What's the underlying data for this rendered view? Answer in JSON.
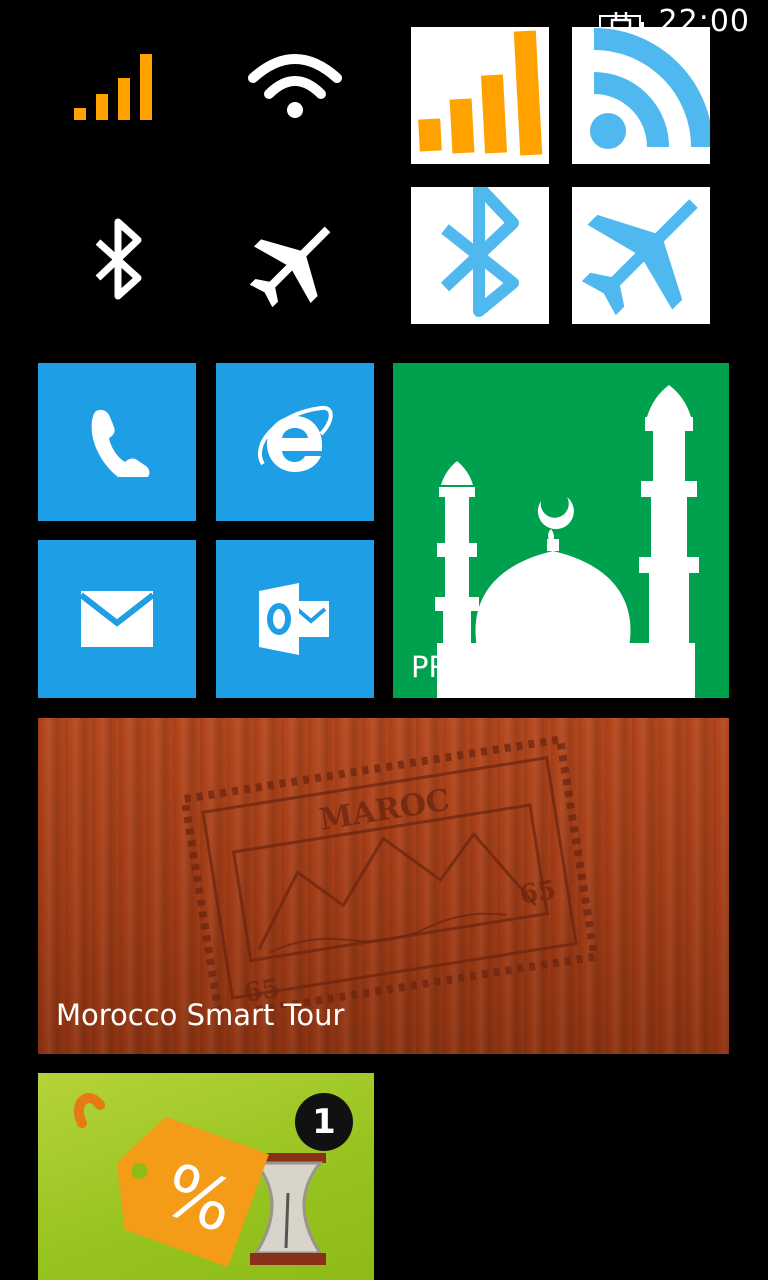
{
  "status_bar": {
    "time": "22:00",
    "battery_icon": "battery-charging-icon"
  },
  "quick_settings": {
    "icons": [
      "signal-strength-icon",
      "wifi-icon",
      "bluetooth-icon",
      "airplane-mode-icon"
    ],
    "accent_colors": {
      "signal": "#ffa200",
      "glyph": "#ffffff"
    }
  },
  "tiles": {
    "signal": {
      "icon": "signal-strength-icon",
      "color": "#ffa200"
    },
    "wifi_rss": {
      "icon": "rss-wifi-icon",
      "color": "#4fb8ef"
    },
    "bluetooth": {
      "icon": "bluetooth-icon",
      "color": "#4fb8ef"
    },
    "airplane": {
      "icon": "airplane-icon",
      "color": "#4fb8ef"
    },
    "phone": {
      "icon": "phone-icon",
      "color": "#1e9ee4"
    },
    "internet_explorer": {
      "icon": "internet-explorer-icon",
      "color": "#1e9ee4"
    },
    "mail": {
      "icon": "mail-icon",
      "color": "#1e9ee4"
    },
    "outlook": {
      "icon": "outlook-icon",
      "color": "#1e9ee4"
    },
    "prayer": {
      "label": "PRAYER",
      "icon": "mosque-icon",
      "color": "#00a14e"
    },
    "morocco": {
      "label": "Morocco Smart Tour",
      "stamp_text": "MAROC",
      "stamp_value": "65"
    },
    "deals": {
      "badge_count": "1",
      "icon": "discount-tag-hourglass-icon"
    }
  }
}
